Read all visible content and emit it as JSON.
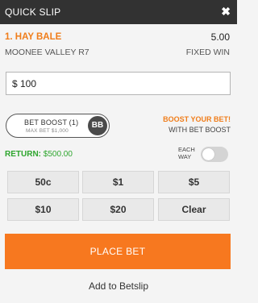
{
  "header": {
    "title": "QUICK SLIP",
    "close_icon": "close-icon"
  },
  "selection": {
    "name": "1. HAY BALE",
    "odds": "5.00",
    "race": "MOONEE VALLEY R7",
    "bet_type": "FIXED WIN"
  },
  "stake": {
    "currency": "$",
    "value": "100"
  },
  "boost": {
    "button_label": "BET BOOST (1)",
    "max_label": "MAX BET $1,000",
    "badge": "BB",
    "promo_title": "BOOST YOUR BET!",
    "promo_sub": "WITH BET BOOST"
  },
  "return": {
    "label": "RETURN:",
    "value": "$500.00"
  },
  "each_way": {
    "line1": "EACH",
    "line2": "WAY",
    "enabled": false
  },
  "quick_stakes": [
    "50c",
    "$1",
    "$5",
    "$10",
    "$20",
    "Clear"
  ],
  "actions": {
    "place_bet": "PLACE BET",
    "add_to_betslip": "Add to Betslip"
  },
  "colors": {
    "accent": "#f7781f",
    "header_bg": "#323232",
    "return_green": "#2da52d"
  }
}
